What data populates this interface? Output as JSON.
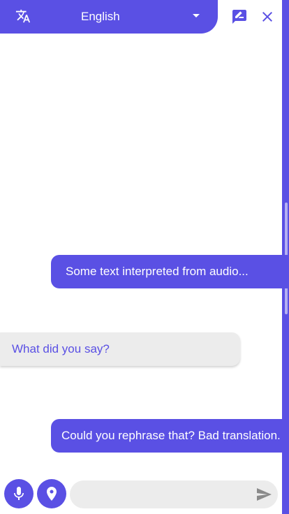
{
  "header": {
    "language": "English",
    "translate_icon": "translate-icon",
    "dropdown_icon": "caret-down-icon"
  },
  "top_actions": {
    "feedback_icon": "rate-review-icon",
    "close_icon": "close-icon"
  },
  "messages": [
    {
      "side": "outgoing",
      "text": "Some text interpreted from audio..."
    },
    {
      "side": "incoming",
      "text": "What did you say?"
    },
    {
      "side": "outgoing",
      "text": "Could you rephrase that? Bad translation."
    }
  ],
  "input_bar": {
    "mic_icon": "microphone-icon",
    "location_icon": "location-pin-icon",
    "input_value": "",
    "input_placeholder": "",
    "send_icon": "send-icon"
  },
  "colors": {
    "accent": "#5a50e4",
    "incoming_bubble": "#ececec",
    "background": "#ffffff"
  }
}
